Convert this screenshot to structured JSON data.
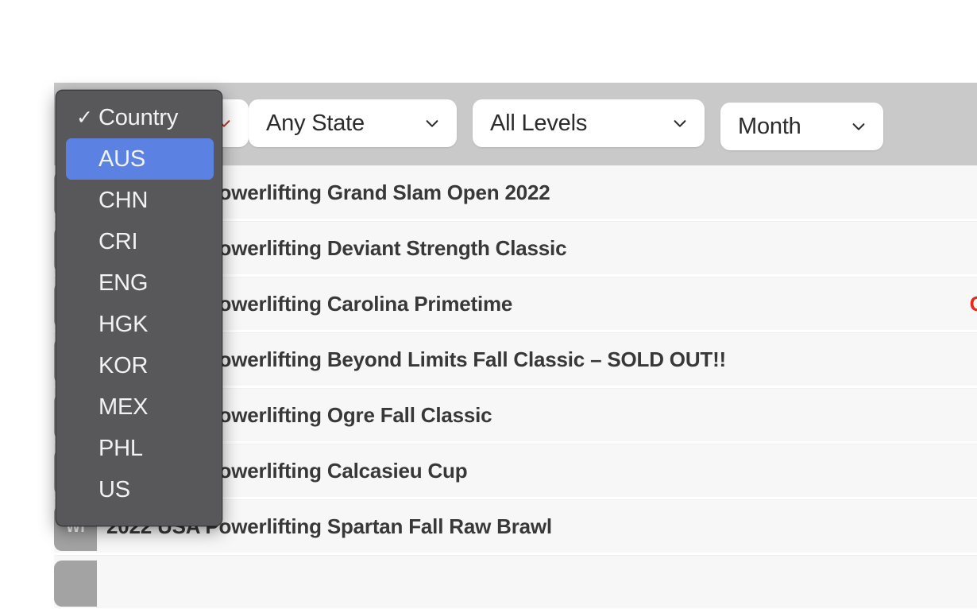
{
  "filters": [
    {
      "name": "country",
      "label": "Country",
      "icon": "chevron-down-icon"
    },
    {
      "name": "state",
      "label": "Any State",
      "icon": "chevron-down-icon"
    },
    {
      "name": "level",
      "label": "All Levels",
      "icon": "chevron-down-icon"
    },
    {
      "name": "month",
      "label": "Month",
      "icon": "chevron-down-icon"
    }
  ],
  "country_menu": {
    "selected": "Country",
    "highlighted": "AUS",
    "check_glyph": "✓",
    "items": [
      {
        "label": "Country",
        "checked": true,
        "highlighted": false
      },
      {
        "label": "AUS",
        "checked": false,
        "highlighted": true
      },
      {
        "label": "CHN",
        "checked": false,
        "highlighted": false
      },
      {
        "label": "CRI",
        "checked": false,
        "highlighted": false
      },
      {
        "label": "ENG",
        "checked": false,
        "highlighted": false
      },
      {
        "label": "HGK",
        "checked": false,
        "highlighted": false
      },
      {
        "label": "KOR",
        "checked": false,
        "highlighted": false
      },
      {
        "label": "MEX",
        "checked": false,
        "highlighted": false
      },
      {
        "label": "PHL",
        "checked": false,
        "highlighted": false
      },
      {
        "label": "US",
        "checked": false,
        "highlighted": false
      }
    ]
  },
  "accent_colors": {
    "menu_background": "#58585a",
    "menu_highlight": "#5b82e2",
    "toolbar_background": "#c9c9c9",
    "row_background": "#f7f7f7",
    "date_red": "#e8281e",
    "badge_gray": "#a3a3a3"
  },
  "results": [
    {
      "badge": "",
      "title": "2022 USA Powerlifting Grand Slam Open 2022",
      "date": ""
    },
    {
      "badge": "",
      "title": "2022 USA Powerlifting Deviant Strength Classic",
      "date": ""
    },
    {
      "badge": "",
      "title": "2022 USA Powerlifting Carolina Primetime",
      "date": "Oct"
    },
    {
      "badge": "",
      "title": "2022 USA Powerlifting Beyond Limits Fall Classic – SOLD OUT!!",
      "date": ""
    },
    {
      "badge": "",
      "title": "2022 USA Powerlifting Ogre Fall Classic",
      "date": ""
    },
    {
      "badge": "",
      "title": "2022 USA Powerlifting Calcasieu Cup",
      "date": ""
    },
    {
      "badge": "WI",
      "title": "2022 USA Powerlifting Spartan Fall Raw Brawl",
      "date": ""
    },
    {
      "badge": "",
      "title": "",
      "date": ""
    }
  ]
}
